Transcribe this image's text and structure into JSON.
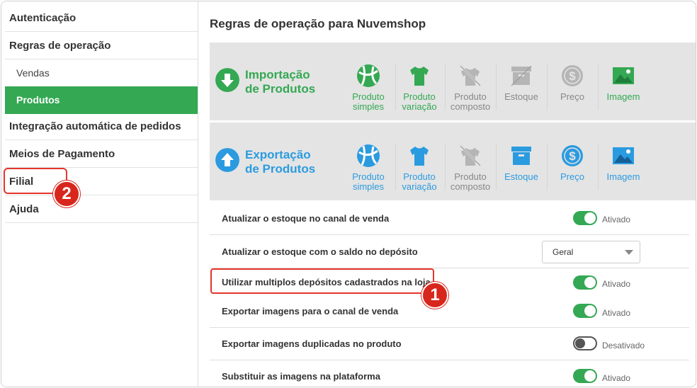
{
  "sidebar": {
    "items": [
      {
        "label": "Autenticação"
      },
      {
        "label": "Regras de operação"
      },
      {
        "label": "Vendas"
      },
      {
        "label": "Produtos"
      },
      {
        "label": "Integração automática de pedidos"
      },
      {
        "label": "Meios de Pagamento"
      },
      {
        "label": "Filial"
      },
      {
        "label": "Ajuda"
      }
    ],
    "active": "Produtos"
  },
  "main": {
    "title": "Regras de operação para Nuvemshop",
    "import": {
      "title_line1": "Importação",
      "title_line2": "de Produtos",
      "color": "#34a853",
      "tiles": [
        {
          "line1": "Produto",
          "line2": "simples",
          "icon": "ball-icon",
          "active": true
        },
        {
          "line1": "Produto",
          "line2": "variação",
          "icon": "shirt-icon",
          "active": true
        },
        {
          "line1": "Produto",
          "line2": "composto",
          "icon": "composite-shirt-icon",
          "active": false
        },
        {
          "line1": "Estoque",
          "line2": "",
          "icon": "box-icon",
          "active": false
        },
        {
          "line1": "Preço",
          "line2": "",
          "icon": "dollar-icon",
          "active": false
        },
        {
          "line1": "Imagem",
          "line2": "",
          "icon": "image-icon",
          "active": true
        }
      ]
    },
    "export": {
      "title_line1": "Exportação",
      "title_line2": "de Produtos",
      "color": "#2b9be0",
      "tiles": [
        {
          "line1": "Produto",
          "line2": "simples",
          "icon": "ball-icon",
          "active": true
        },
        {
          "line1": "Produto",
          "line2": "variação",
          "icon": "shirt-icon",
          "active": true
        },
        {
          "line1": "Produto",
          "line2": "composto",
          "icon": "composite-shirt-icon",
          "active": false
        },
        {
          "line1": "Estoque",
          "line2": "",
          "icon": "box-icon",
          "active": true
        },
        {
          "line1": "Preço",
          "line2": "",
          "icon": "dollar-icon",
          "active": true
        },
        {
          "line1": "Imagem",
          "line2": "",
          "icon": "image-icon",
          "active": true
        }
      ]
    },
    "settings": [
      {
        "label": "Atualizar o estoque no canal de venda",
        "type": "toggle",
        "state": "Ativado",
        "on": true
      },
      {
        "label": "Atualizar o estoque com o saldo no depósito",
        "type": "select",
        "value": "Geral"
      },
      {
        "label": "Utilizar multiplos depósitos cadastrados na loja",
        "type": "toggle",
        "state": "Ativado",
        "on": true
      },
      {
        "label": "Exportar imagens para o canal de venda",
        "type": "toggle",
        "state": "Ativado",
        "on": true
      },
      {
        "label": "Exportar imagens duplicadas no produto",
        "type": "toggle",
        "state": "Desativado",
        "on": false
      },
      {
        "label": "Substituir as imagens na plataforma",
        "type": "toggle",
        "state": "Ativado",
        "on": true
      }
    ]
  },
  "annotations": {
    "badge1": "1",
    "badge2": "2",
    "highlight_color": "#e5352b"
  }
}
